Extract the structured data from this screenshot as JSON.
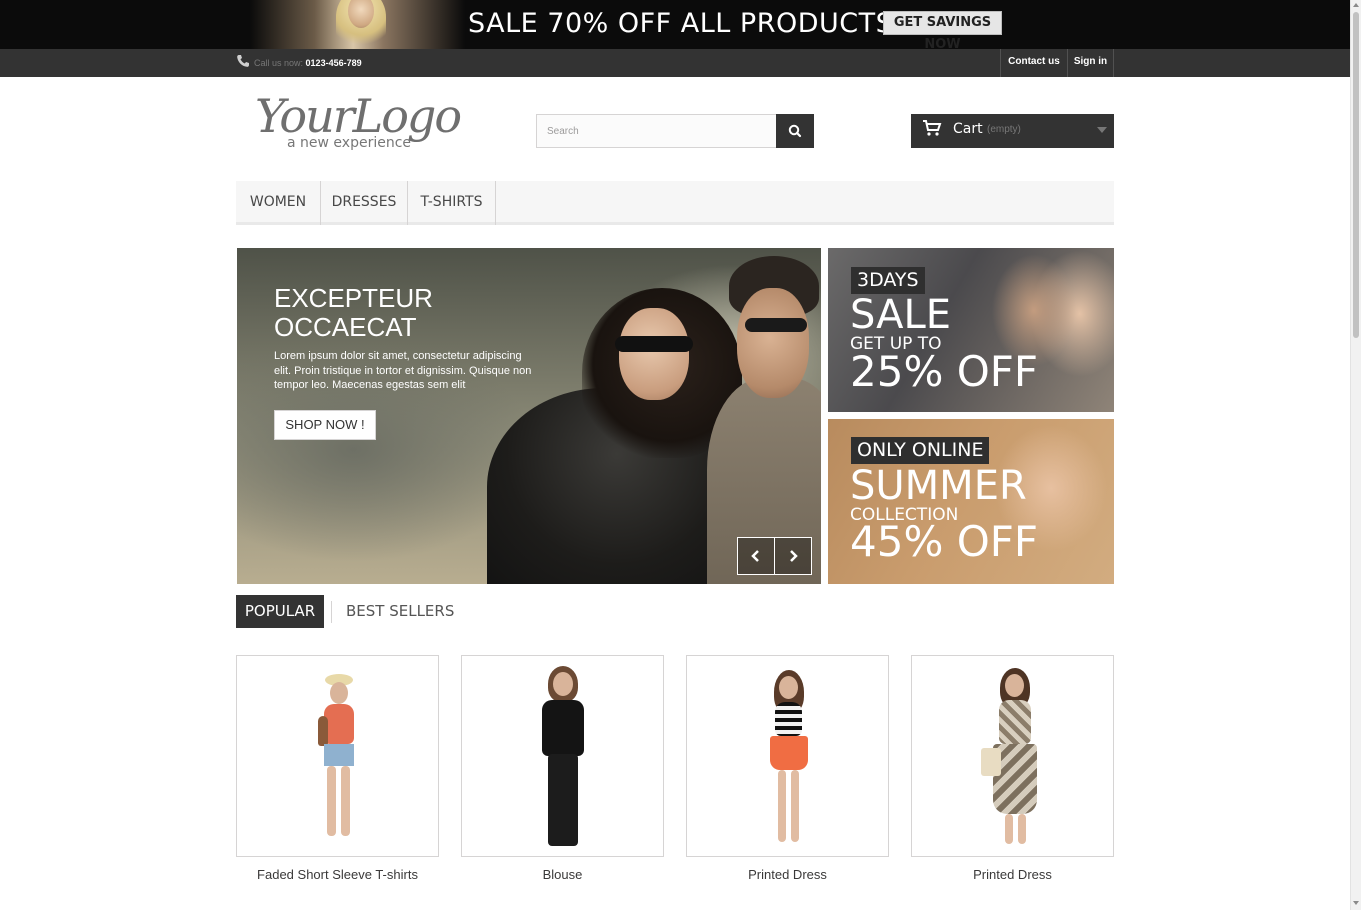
{
  "promo": {
    "title": "SALE 70% OFF ALL PRODUCTS",
    "button": "GET SAVINGS NOW"
  },
  "topbar": {
    "call_label": "Call us now:",
    "phone": "0123-456-789",
    "contact": "Contact us",
    "signin": "Sign in"
  },
  "logo": {
    "main": "YourLogo",
    "sub": "a new experience"
  },
  "search": {
    "placeholder": "Search"
  },
  "cart": {
    "label": "Cart",
    "status": "(empty)"
  },
  "menu": {
    "items": [
      {
        "label": "WOMEN"
      },
      {
        "label": "DRESSES"
      },
      {
        "label": "T-SHIRTS"
      }
    ]
  },
  "slider": {
    "title": "EXCEPTEUR OCCAECAT",
    "text": "Lorem ipsum dolor sit amet, consectetur adipiscing elit. Proin tristique in tortor et dignissim. Quisque non tempor leo. Maecenas egestas sem elit",
    "button": "SHOP NOW !"
  },
  "banners": [
    {
      "tag": "3DAYS",
      "headline": "SALE",
      "sub": "GET UP TO",
      "percent": "25% OFF"
    },
    {
      "tag": "ONLY ONLINE",
      "headline": "SUMMER",
      "sub": "COLLECTION",
      "percent": "45% OFF"
    }
  ],
  "tabs": {
    "popular": "POPULAR",
    "best": "BEST SELLERS"
  },
  "products": [
    {
      "name": "Faded Short Sleeve T-shirts"
    },
    {
      "name": "Blouse"
    },
    {
      "name": "Printed Dress"
    },
    {
      "name": "Printed Dress"
    }
  ]
}
